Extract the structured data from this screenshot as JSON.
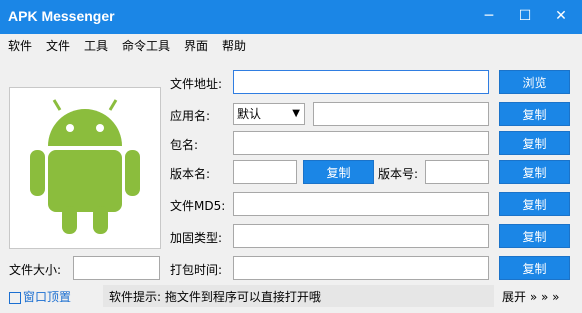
{
  "window": {
    "title": "APK Messenger",
    "minimize": "─",
    "maximize": "☐",
    "close": "✕"
  },
  "menu": {
    "items": [
      "软件",
      "文件",
      "工具",
      "命令工具",
      "界面",
      "帮助"
    ]
  },
  "colors": {
    "accent": "#1b86e6",
    "logo": "#8bbd3d"
  },
  "fields": {
    "file_path_label": "文件地址:",
    "app_name_label": "应用名:",
    "app_name_select": "默认",
    "package_label": "包名:",
    "version_name_label": "版本名:",
    "version_code_label": "版本号:",
    "file_md5_label": "文件MD5:",
    "protection_label": "加固类型:",
    "pack_time_label": "打包时间:",
    "file_size_label": "文件大小:"
  },
  "buttons": {
    "browse": "浏览",
    "copy": "复制"
  },
  "footer": {
    "topmost_label": "窗口顶置",
    "status_text": "软件提示: 拖文件到程序可以直接打开哦",
    "expand_label": "展开 » » »"
  },
  "icons": {
    "logo": "android-logo-icon",
    "checkbox": "checkbox-icon"
  }
}
